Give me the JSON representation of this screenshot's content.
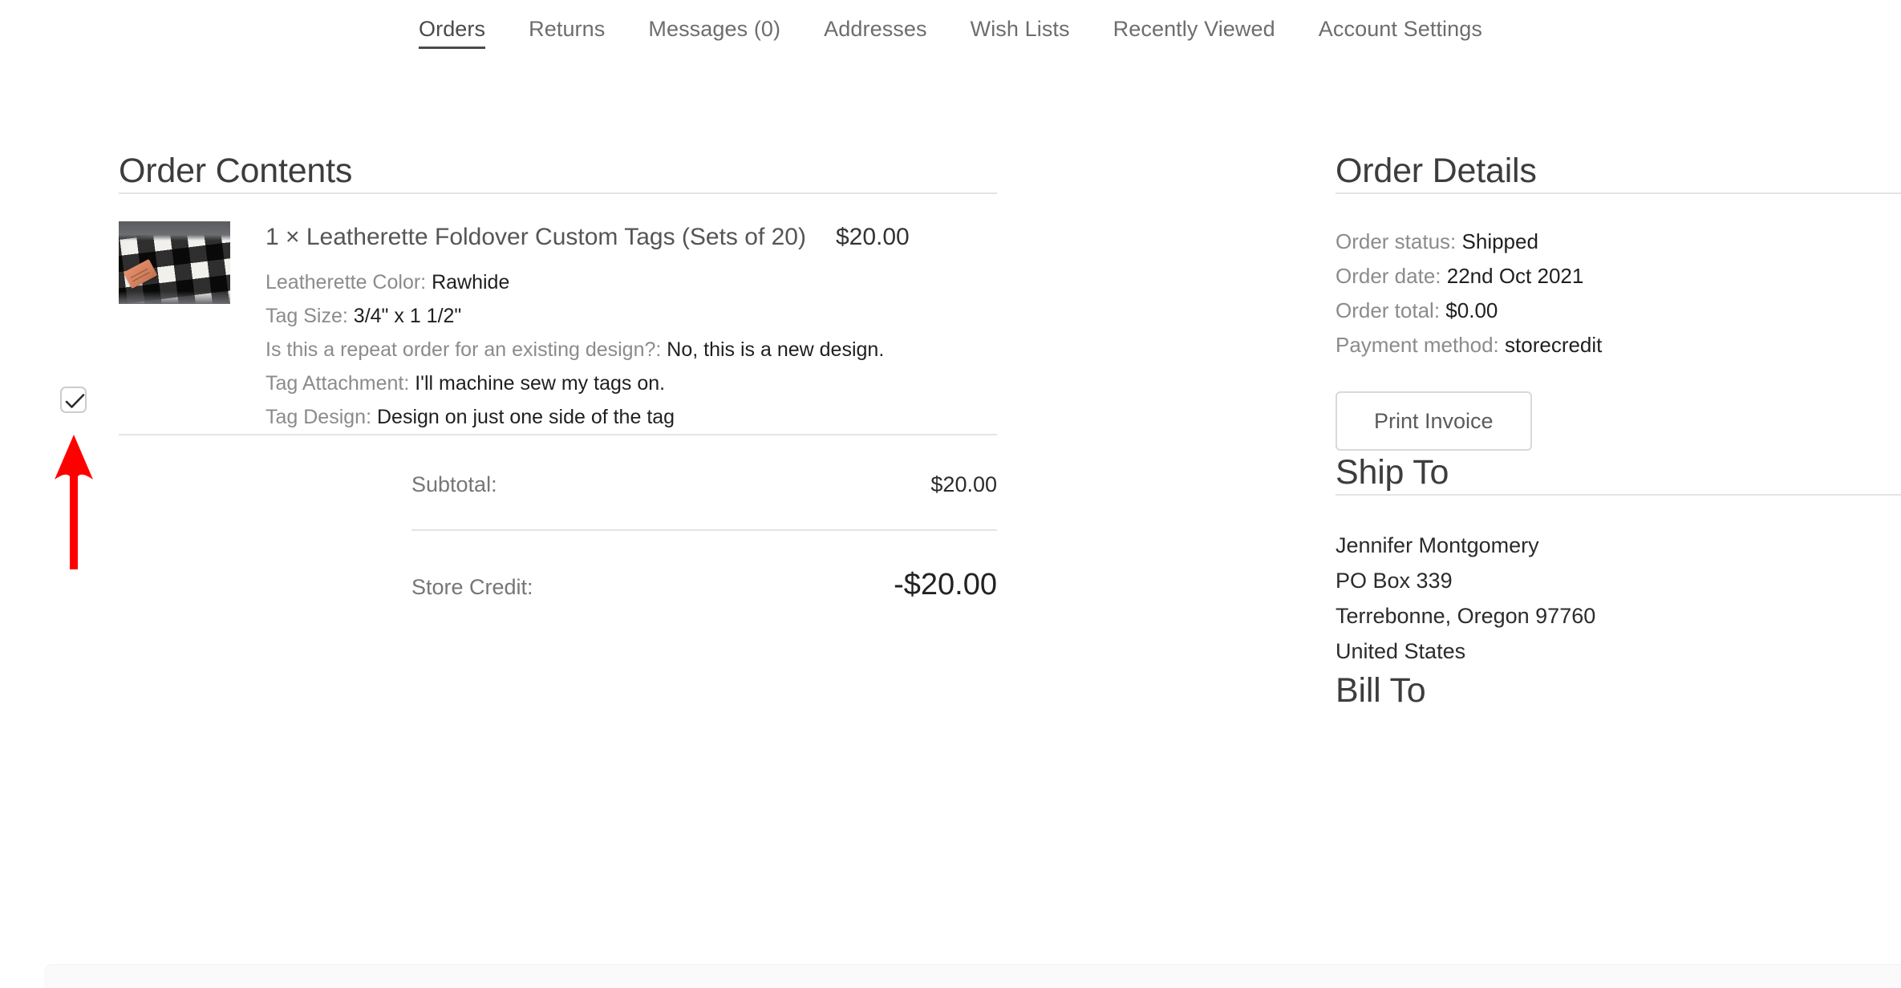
{
  "account_nav": {
    "items": [
      {
        "label": "Orders",
        "active": true
      },
      {
        "label": "Returns",
        "active": false
      },
      {
        "label": "Messages (0)",
        "active": false
      },
      {
        "label": "Addresses",
        "active": false
      },
      {
        "label": "Wish Lists",
        "active": false
      },
      {
        "label": "Recently Viewed",
        "active": false
      },
      {
        "label": "Account Settings",
        "active": false
      }
    ]
  },
  "order_contents": {
    "title": "Order Contents",
    "item": {
      "quantity_prefix": "1 × ",
      "name": "Leatherette Foldover Custom Tags (Sets of 20)",
      "title_full": "1 × Leatherette Foldover Custom Tags (Sets of 20)",
      "price": "$20.00",
      "thumbnail_alt": "black and white buffalo check fabric with rawhide leather tag",
      "attributes": [
        {
          "label": "Leatherette Color:",
          "value": "Rawhide"
        },
        {
          "label": "Tag Size:",
          "value": "3/4\" x 1 1/2\""
        },
        {
          "label": "Is this a repeat order for an existing design?:",
          "value": "No, this is a new design."
        },
        {
          "label": "Tag Attachment:",
          "value": "I'll machine sew my tags on."
        },
        {
          "label": "Tag Design:",
          "value": "Design on just one side of the tag"
        }
      ]
    },
    "totals": [
      {
        "label": "Subtotal:",
        "value": "$20.00"
      },
      {
        "label": "Store Credit:",
        "value": "-$20.00"
      }
    ]
  },
  "order_details": {
    "title": "Order Details",
    "rows": [
      {
        "label": "Order status:",
        "value": "Shipped"
      },
      {
        "label": "Order date:",
        "value": "22nd Oct 2021"
      },
      {
        "label": "Order total:",
        "value": "$0.00"
      },
      {
        "label": "Payment method:",
        "value": "storecredit"
      }
    ],
    "print_invoice_label": "Print Invoice"
  },
  "ship_to": {
    "title": "Ship To",
    "lines": [
      "Jennifer Montgomery",
      "PO Box 339",
      "Terrebonne, Oregon 97760",
      "United States"
    ]
  },
  "bill_to": {
    "title": "Bill To"
  },
  "annotation": {
    "arrow_color": "#ff0000",
    "checkbox_checked": true
  },
  "colors": {
    "text_dark": "#1f1f1f",
    "text_muted": "#8b8b8b",
    "heading": "#3d3d3d",
    "rule": "#e4e4e4",
    "annotation_red": "#ff0000"
  }
}
